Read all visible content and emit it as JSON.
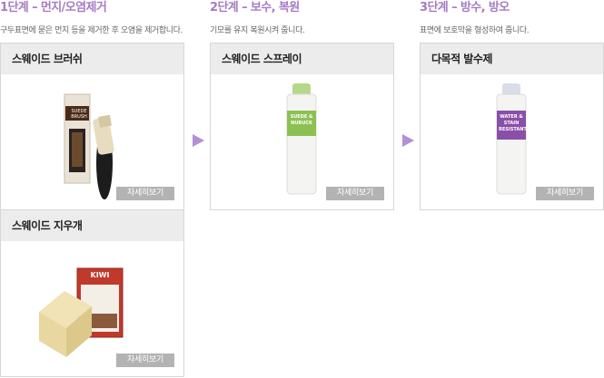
{
  "steps": [
    {
      "title": "1단계 – 먼지/오염제거",
      "desc": "구두표면에 묻은 먼지 등을 제거한 후 오염을 제거합니다.",
      "products": [
        {
          "name": "스웨이드 브러쉬",
          "button": "자세히보기",
          "box_text": "SUEDE BRUSH"
        },
        {
          "name": "스웨이드 지우개",
          "button": "자세히보기",
          "box_text": "KIWI"
        }
      ]
    },
    {
      "title": "2단계 – 보수, 복원",
      "desc": "기모를 유지 복원시켜 줍니다.",
      "products": [
        {
          "name": "스웨이드 스프레이",
          "button": "자세히보기",
          "can_text": "SUEDE & NUBUCK"
        }
      ]
    },
    {
      "title": "3단계 –  방수, 방오",
      "desc": "표면에 보호막을 형성하여 줍니다.",
      "products": [
        {
          "name": "다목적 발수제",
          "button": "자세히보기",
          "can_text": "WATER & STAIN RESISTANT"
        }
      ]
    }
  ],
  "colors": {
    "accent": "#a67bc4",
    "arrow": "#b48fd6",
    "header_bg": "#ececec",
    "button_bg": "#b3b3b3",
    "border": "#d6d6d6",
    "green_label": "#8cc152",
    "purple_label": "#8a4fa8"
  },
  "icons": [
    "arrow-right-icon"
  ]
}
